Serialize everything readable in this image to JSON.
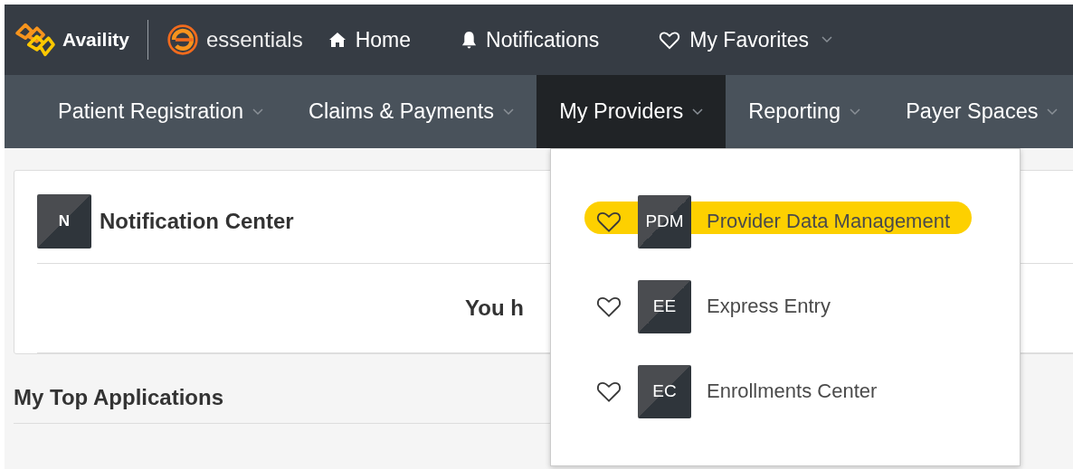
{
  "header": {
    "brand": "Availity",
    "product": "essentials",
    "links": [
      {
        "kind": "home",
        "label": "Home"
      },
      {
        "kind": "bell",
        "label": "Notifications"
      },
      {
        "kind": "heart",
        "label": "My Favorites",
        "dropdown": true
      }
    ]
  },
  "nav": [
    {
      "label": "Patient Registration",
      "selected": false
    },
    {
      "label": "Claims & Payments",
      "selected": false
    },
    {
      "label": "My Providers",
      "selected": true
    },
    {
      "label": "Reporting",
      "selected": false
    },
    {
      "label": "Payer Spaces",
      "selected": false
    }
  ],
  "notification_card": {
    "badge": "N",
    "title": "Notification Center",
    "message": "You h"
  },
  "section_title": "My Top Applications",
  "menu": {
    "items": [
      {
        "badge": "PDM",
        "label": "Provider Data Management",
        "highlighted": true
      },
      {
        "badge": "EE",
        "label": "Express Entry",
        "highlighted": false
      },
      {
        "badge": "EC",
        "label": "Enrollments Center",
        "highlighted": false
      }
    ]
  }
}
